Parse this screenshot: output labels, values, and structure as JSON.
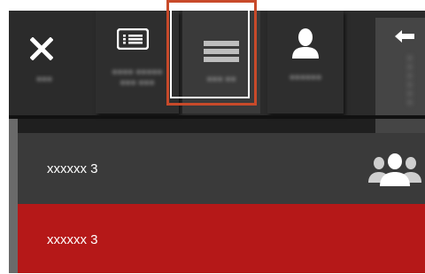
{
  "toolbar": {
    "buttons": [
      {
        "name": "close",
        "icon": "close-icon",
        "label": "●●●"
      },
      {
        "name": "list",
        "icon": "list-icon",
        "label": "●●●● ●●●●● ●●● ●●●"
      },
      {
        "name": "menu",
        "icon": "menu-icon",
        "label": "●●● ●●"
      },
      {
        "name": "user",
        "icon": "user-icon",
        "label": "●●●●●●"
      }
    ],
    "side_panel": {
      "icon": "arrow-left-icon",
      "label": "●●●●●●"
    }
  },
  "list": {
    "items": [
      {
        "label": "xxxxxx 3",
        "icon": "group-icon"
      },
      {
        "label": "xxxxxx 3"
      }
    ]
  },
  "colors": {
    "toolbar_bg": "#2b2b2b",
    "selected_row": "#b51818",
    "highlight_border": "#c84a2a"
  }
}
